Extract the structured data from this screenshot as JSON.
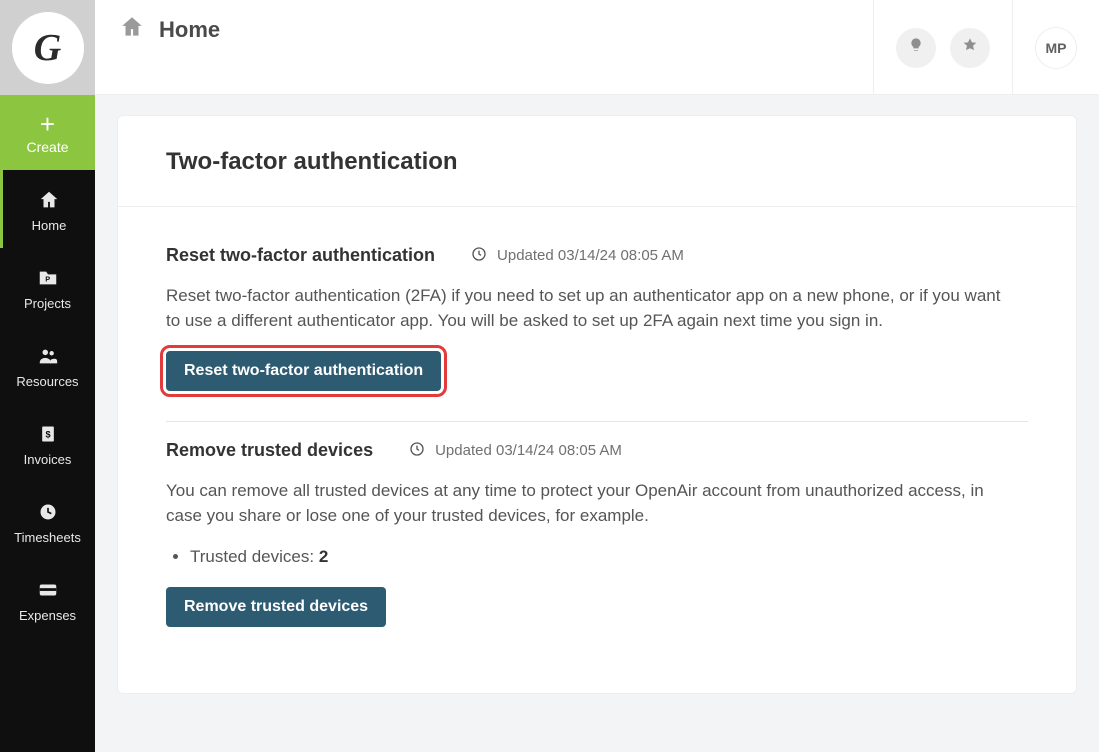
{
  "logo_letter": "G",
  "sidebar": {
    "create_label": "Create",
    "items": [
      {
        "label": "Home"
      },
      {
        "label": "Projects"
      },
      {
        "label": "Resources"
      },
      {
        "label": "Invoices"
      },
      {
        "label": "Timesheets"
      },
      {
        "label": "Expenses"
      }
    ]
  },
  "header": {
    "title": "Home",
    "avatar_initials": "MP"
  },
  "page": {
    "title": "Two-factor authentication",
    "sections": [
      {
        "title": "Reset two-factor authentication",
        "updated": "Updated 03/14/24 08:05 AM",
        "description": "Reset two-factor authentication (2FA) if you need to set up an authenticator app on a new phone, or if you want to use a different authenticator app. You will be asked to set up 2FA again next time you sign in.",
        "button": "Reset two-factor authentication"
      },
      {
        "title": "Remove trusted devices",
        "updated": "Updated 03/14/24 08:05 AM",
        "description": "You can remove all trusted devices at any time to protect your OpenAir account from unauthorized access, in case you share or lose one of your trusted devices, for example.",
        "trusted_label": "Trusted devices: ",
        "trusted_count": "2",
        "button": "Remove trusted devices"
      }
    ]
  }
}
